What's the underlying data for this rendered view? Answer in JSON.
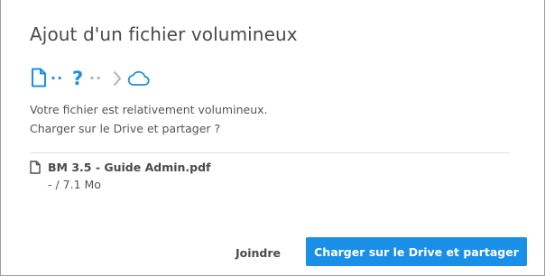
{
  "dialog": {
    "title": "Ajout d'un fichier volumineux",
    "steps": {
      "icons": [
        "file-icon",
        "question-mark",
        "chevron-right-icon",
        "cloud-icon"
      ],
      "active_color": "#1a8fe8",
      "inactive_color": "#b3b3b3",
      "question_mark": "?",
      "dots_active": "··",
      "dots_inactive": "··"
    },
    "message_line1": "Votre fichier est relativement volumineux.",
    "message_line2": "Charger sur le Drive et partager ?",
    "file": {
      "name": "BM 3.5 - Guide Admin.pdf",
      "size": "- / 7.1 Mo"
    },
    "buttons": {
      "attach_label": "Joindre",
      "upload_label": "Charger sur le Drive et partager"
    },
    "colors": {
      "accent": "#1a8fe8",
      "text": "#4a4a4a"
    }
  }
}
